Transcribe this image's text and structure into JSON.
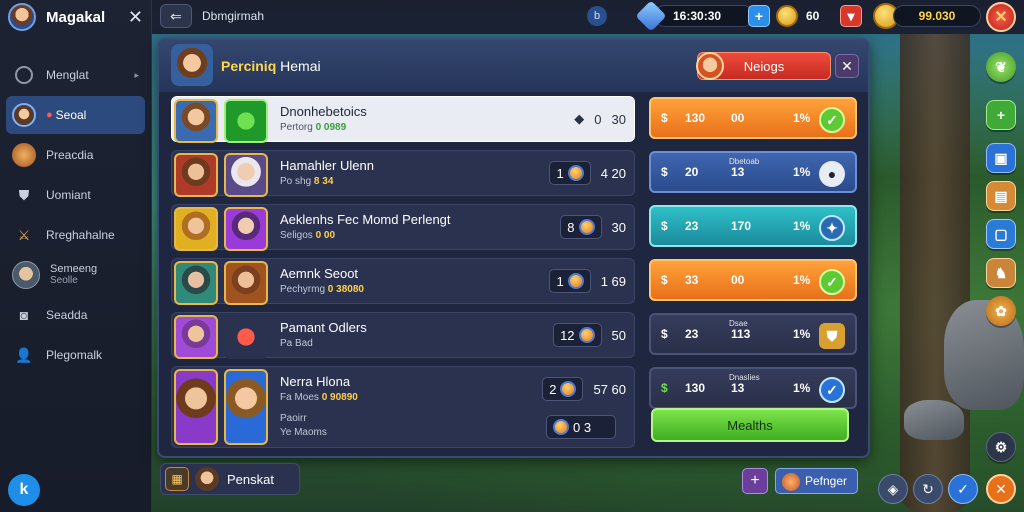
{
  "colors": {
    "accent_blue": "#2c4a7e",
    "orange": "#f08a2a",
    "teal": "#27a9b5",
    "green": "#5cc935",
    "red": "#d8372b",
    "gold": "#ffd54f"
  },
  "sidebar": {
    "title": "Magakal",
    "items": [
      {
        "label": "Menglat",
        "icon": "circle-icon"
      },
      {
        "label": "Seoal",
        "icon": "hero-icon"
      },
      {
        "label": "Preacdia",
        "icon": "chest-icon"
      },
      {
        "label": "Uomiant",
        "icon": "shield-icon"
      },
      {
        "label": "Rreghahalne",
        "icon": "sword-icon"
      },
      {
        "label": "Semeeng",
        "sub": "Seolle",
        "icon": "avatar-icon"
      },
      {
        "label": "Seadda",
        "icon": "camera-icon"
      },
      {
        "label": "Plegomalk",
        "icon": "user-icon"
      }
    ],
    "bottom_icon": "app-logo-icon",
    "bottom_label": "k"
  },
  "topbar": {
    "title": "Dbmgirmah",
    "badge": "b",
    "gems": "16:30:30",
    "coins": "60",
    "gold": "99.030"
  },
  "panel": {
    "title_highlight": "Perciniq",
    "title_rest": "Hemai",
    "red_button": "Neiogs",
    "rows": [
      {
        "name": "Dnonhebetoics",
        "sub_label": "Pertorg",
        "sub_value": "0 0989",
        "count_a": "0",
        "count_b": "30"
      },
      {
        "name": "Hamahler Ulenn",
        "sub_label": "Po shg",
        "sub_value": "8 34",
        "count_a": "1",
        "count_b": "4  20"
      },
      {
        "name": "Aeklenhs Fec Momd Perlengt",
        "sub_label": "Seligos",
        "sub_value": "0 00",
        "count_a": "8",
        "count_b": "30"
      },
      {
        "name": "Aemnk Seoot",
        "sub_label": "Pechyrmg",
        "sub_value": "0 38080",
        "count_a": "1",
        "count_b": "1  69"
      },
      {
        "name": "Pamant Odlers",
        "sub_label": "Pa Bad",
        "sub_value": "",
        "count_a": "12",
        "count_b": "50"
      },
      {
        "name": "Nerra Hlona",
        "sub_label": "Fa Moes",
        "sub_value": "0 90890",
        "count_a": "2",
        "count_b": "57  60"
      }
    ],
    "row6_extra": {
      "name": "Paoirr",
      "sub": "Ye Maoms",
      "count": "0 3"
    },
    "rbars": [
      {
        "a": "$",
        "b": "130",
        "c": "00",
        "d": "1%",
        "tiny": ""
      },
      {
        "a": "$",
        "b": "20",
        "c": "13",
        "d": "1%",
        "tiny": "Dbetoab"
      },
      {
        "a": "$",
        "b": "23",
        "c": "170",
        "d": "1%",
        "tiny": ""
      },
      {
        "a": "$",
        "b": "33",
        "c": "00",
        "d": "1%",
        "tiny": ""
      },
      {
        "a": "$",
        "b": "23",
        "c": "113",
        "d": "1%",
        "tiny": "Dsae"
      },
      {
        "a": "$",
        "b": "130",
        "c": "13",
        "d": "1%",
        "tiny": "Dnaslies"
      }
    ],
    "green_button": "Mealths"
  },
  "bottom": {
    "label": "Penskat",
    "pager_label": "Pefnger"
  }
}
